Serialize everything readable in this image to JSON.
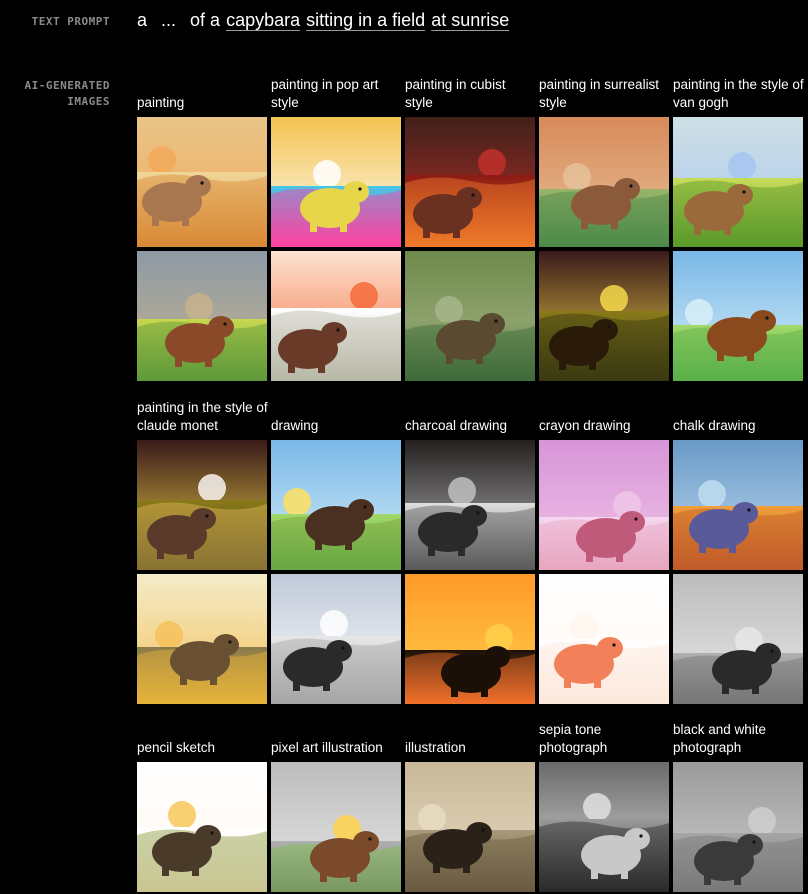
{
  "labels": {
    "prompt": "TEXT PROMPT",
    "images": "AI-GENERATED IMAGES"
  },
  "prompt": {
    "lead": "a",
    "ellipsis": "...",
    "middle": "of a",
    "subject": "capybara",
    "setting": "sitting in a field",
    "time": "at sunrise"
  },
  "groups": [
    {
      "styles": [
        "painting",
        "painting in pop art style",
        "painting in cubist style",
        "painting in surrealist style",
        "painting in the style of van gogh"
      ]
    },
    {
      "styles": [
        "painting in the style of claude monet",
        "drawing",
        "charcoal drawing",
        "crayon drawing",
        "chalk drawing"
      ]
    },
    {
      "styles": [
        "pencil sketch",
        "pixel art illustration",
        "illustration",
        "sepia tone photograph",
        "black and white photograph"
      ]
    }
  ]
}
